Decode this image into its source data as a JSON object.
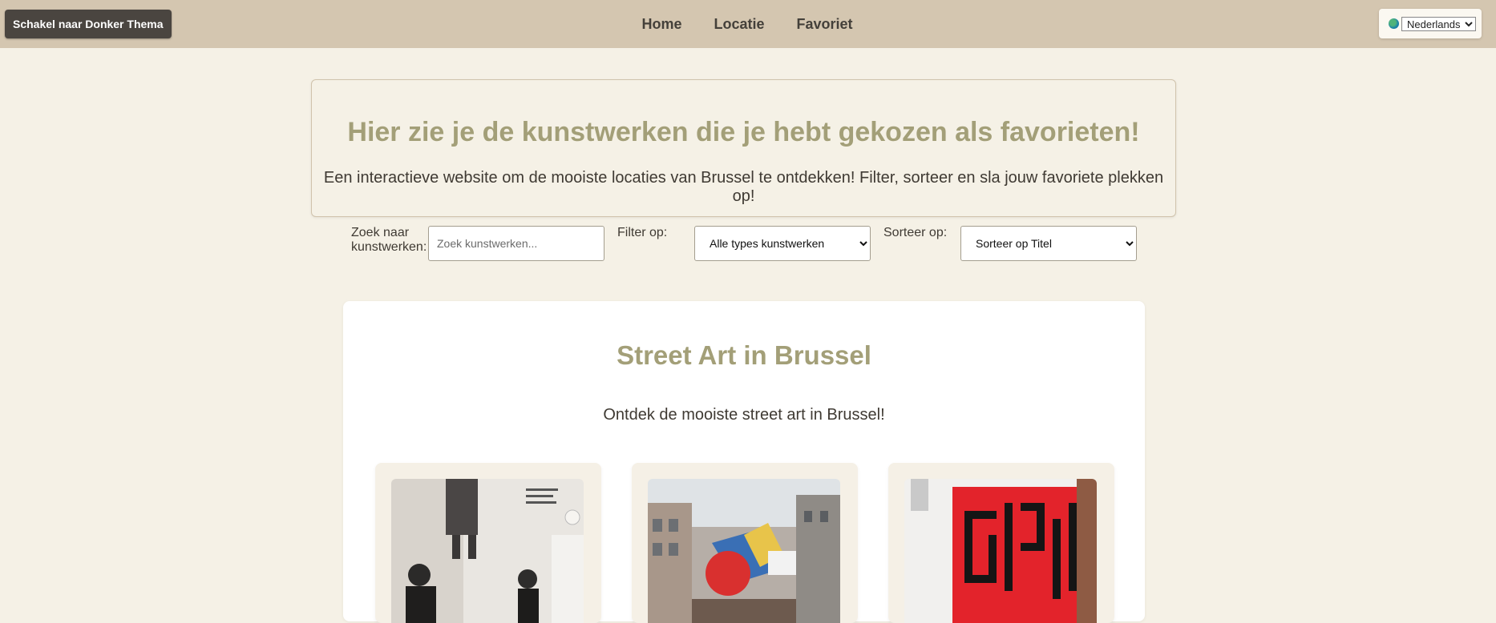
{
  "header": {
    "theme_button": "Schakel naar Donker Thema",
    "nav": [
      "Home",
      "Locatie",
      "Favoriet"
    ],
    "language": {
      "selected": "Nederlands",
      "icon": "globe-icon"
    }
  },
  "hero": {
    "title": "Hier zie je de kunstwerken die je hebt gekozen als favorieten!",
    "subtitle": "Een interactieve website om de mooiste locaties van Brussel te ontdekken! Filter, sorteer en sla jouw favoriete plekken op!"
  },
  "filters": {
    "search_label_1": "Zoek naar",
    "search_label_2": "kunstwerken:",
    "search_placeholder": "Zoek kunstwerken...",
    "filter_label": "Filter op:",
    "filter_selected": "Alle types kunstwerken",
    "sort_label": "Sorteer op:",
    "sort_selected": "Sorteer op Titel"
  },
  "section": {
    "title": "Street Art in Brussel",
    "subtitle": "Ontdek de mooiste street art in Brussel!"
  },
  "colors": {
    "header_bg": "#d4c6b0",
    "page_bg": "#f5f1e6",
    "accent_title": "#a39f78",
    "button_dark": "#4a4540"
  }
}
